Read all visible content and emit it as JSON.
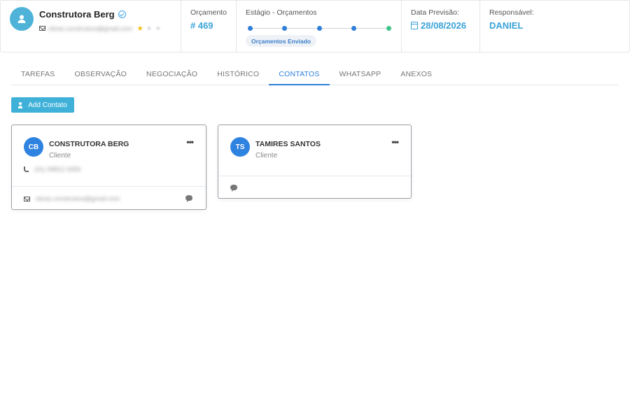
{
  "header": {
    "client_name": "Construtora Berg",
    "client_email": "obras.construtora@gmail.com",
    "rating": {
      "value": 1,
      "max": 3
    },
    "orcamento_label": "Orçamento",
    "orcamento_value": "# 469",
    "stage_label": "Estágio - Orçamentos",
    "stage_current": "Orçamentos Enviado",
    "date_label": "Data Previsão:",
    "date_value": "28/08/2026",
    "resp_label": "Responsável:",
    "resp_value": "DANIEL"
  },
  "tabs": [
    {
      "label": "TAREFAS"
    },
    {
      "label": "OBSERVAÇÃO"
    },
    {
      "label": "NEGOCIAÇÃO"
    },
    {
      "label": "HISTÓRICO"
    },
    {
      "label": "CONTATOS",
      "active": true
    },
    {
      "label": "WHATSAPP"
    },
    {
      "label": "ANEXOS"
    }
  ],
  "add_contact_label": "Add Contato",
  "contacts": [
    {
      "initials": "CB",
      "name": "CONSTRUTORA BERG",
      "role": "Cliente",
      "phone": "(41) 99812-3456",
      "email": "obras.construtora@gmail.com",
      "menu": "•••"
    },
    {
      "initials": "TS",
      "name": "TAMIRES SANTOS",
      "role": "Cliente",
      "menu": "•••"
    }
  ],
  "colors": {
    "accent": "#3aa3d8",
    "primary": "#2f7fd9",
    "button": "#3fb1d8",
    "stage_done": "#2f7fd9",
    "stage_last": "#3ec48a"
  }
}
